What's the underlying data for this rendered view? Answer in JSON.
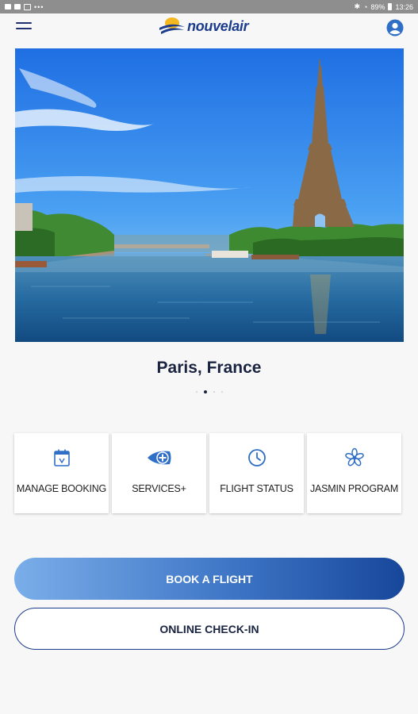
{
  "status_bar": {
    "battery": "89%",
    "time": "13:26"
  },
  "header": {
    "logo_text": "nouvelair"
  },
  "hero": {
    "destination": "Paris, France",
    "carousel": {
      "count": 4,
      "active_index": 1
    }
  },
  "quick_actions": [
    {
      "label": "MANAGE BOOKING",
      "icon": "calendar-icon"
    },
    {
      "label": "SERVICES+",
      "icon": "services-plus-icon"
    },
    {
      "label": "FLIGHT STATUS",
      "icon": "clock-icon"
    },
    {
      "label": "JASMIN PROGRAM",
      "icon": "jasmine-flower-icon"
    }
  ],
  "buttons": {
    "book_flight": "BOOK A FLIGHT",
    "online_checkin": "ONLINE CHECK-IN"
  },
  "colors": {
    "brand_navy": "#1b3c8c",
    "brand_light_blue": "#7aaee9",
    "icon_blue": "#2f6fc6"
  }
}
